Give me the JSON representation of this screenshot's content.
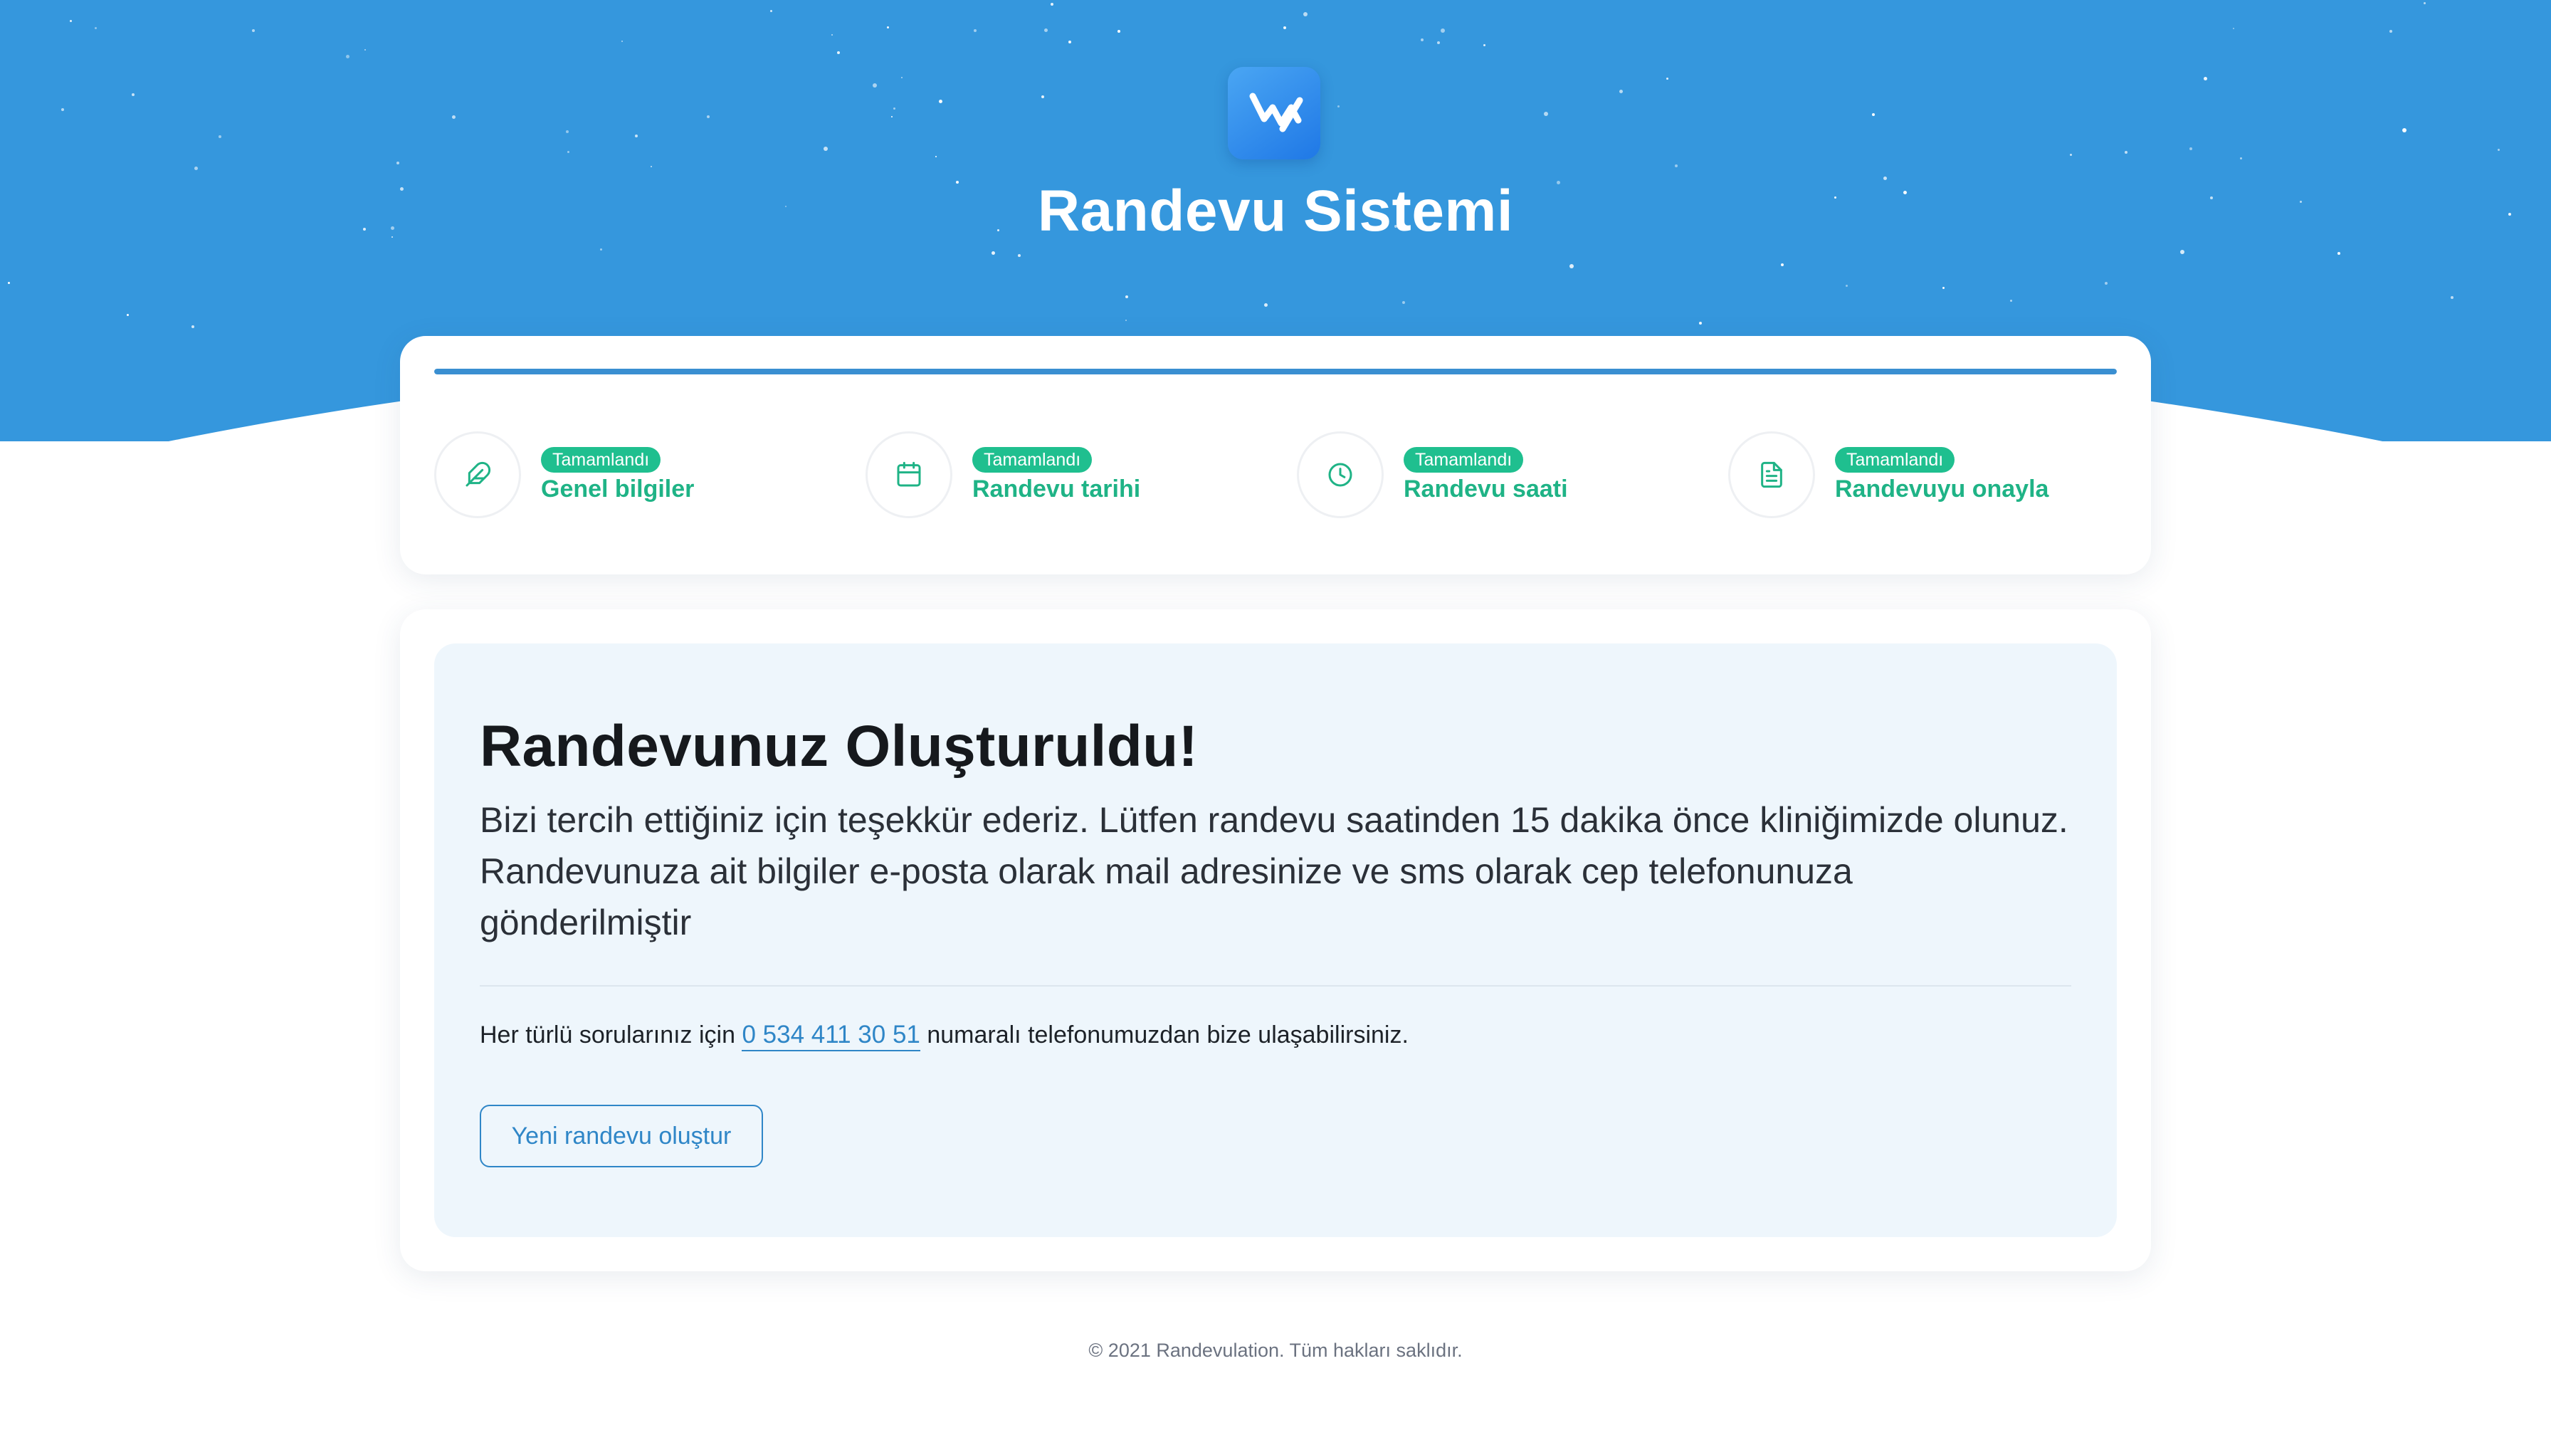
{
  "header": {
    "logo_icon": "brand-logo-icon",
    "title": "Randevu Sistemi"
  },
  "colors": {
    "hero_background": "#3597dd",
    "accent": "#2f86c7",
    "completed": "#1fbf8f"
  },
  "progress": {
    "percent": 100
  },
  "steps": [
    {
      "icon": "feather-icon",
      "status": "Tamamlandı",
      "label": "Genel bilgiler"
    },
    {
      "icon": "calendar-icon",
      "status": "Tamamlandı",
      "label": "Randevu tarihi"
    },
    {
      "icon": "clock-icon",
      "status": "Tamamlandı",
      "label": "Randevu saati"
    },
    {
      "icon": "document-icon",
      "status": "Tamamlandı",
      "label": "Randevuyu onayla"
    }
  ],
  "confirmation": {
    "heading": "Randevunuz Oluşturuldu!",
    "description": "Bizi tercih ettiğiniz için teşekkür ederiz. Lütfen randevu saatinden 15 dakika önce kliniğimizde olunuz. Randevunuza ait bilgiler e-posta olarak mail adresinize ve sms olarak cep telefonunuza gönderilmiştir",
    "contact_before": "Her türlü sorularınız için ",
    "contact_phone": "0 534 411 30 51",
    "contact_after": " numaralı telefonumuzdan bize ulaşabilirsiniz.",
    "new_button": "Yeni randevu oluştur"
  },
  "footer": {
    "copyright": "© 2021 Randevulation. Tüm hakları saklıdır."
  }
}
